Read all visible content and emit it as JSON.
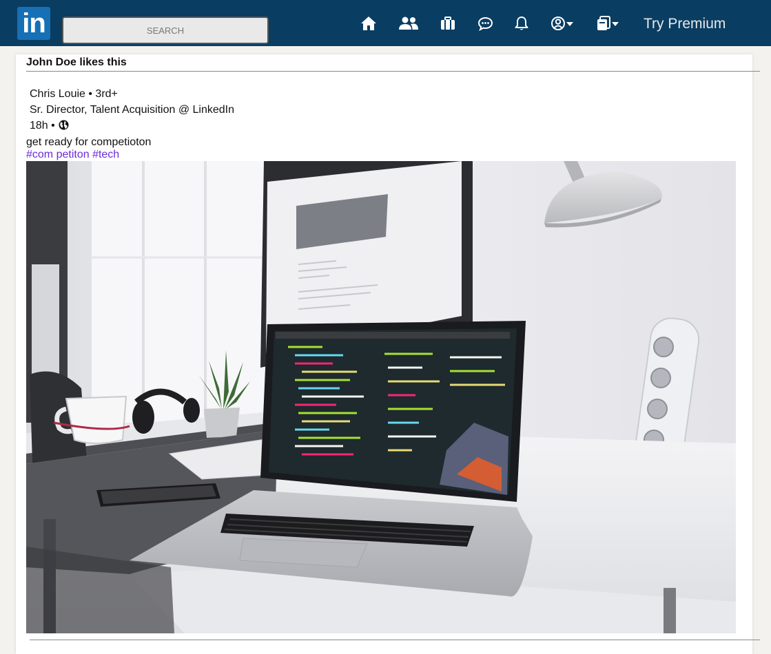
{
  "app": {
    "logo_text": "in",
    "colors": {
      "topbar": "#0a3d62",
      "logo_bg": "#1670b5",
      "hashtag": "#6b2bd9"
    }
  },
  "search": {
    "placeholder": "SEARCH"
  },
  "nav": {
    "icons": [
      "home-icon",
      "people-icon",
      "briefcase-icon",
      "messaging-icon",
      "bell-icon",
      "profile-dropdown-icon",
      "work-dropdown-icon"
    ],
    "premium_label": "Try Premium"
  },
  "post": {
    "liked_by": "John Doe likes this",
    "author_line": "Chris Louie • 3rd+",
    "headline": "Sr. Director, Talent Acquisition @ LinkedIn",
    "time": "18h •",
    "text": "get ready for competioton",
    "hashtags": [
      "#com petiton",
      "#tech"
    ],
    "image_icon": "laptop-desk-photo"
  }
}
